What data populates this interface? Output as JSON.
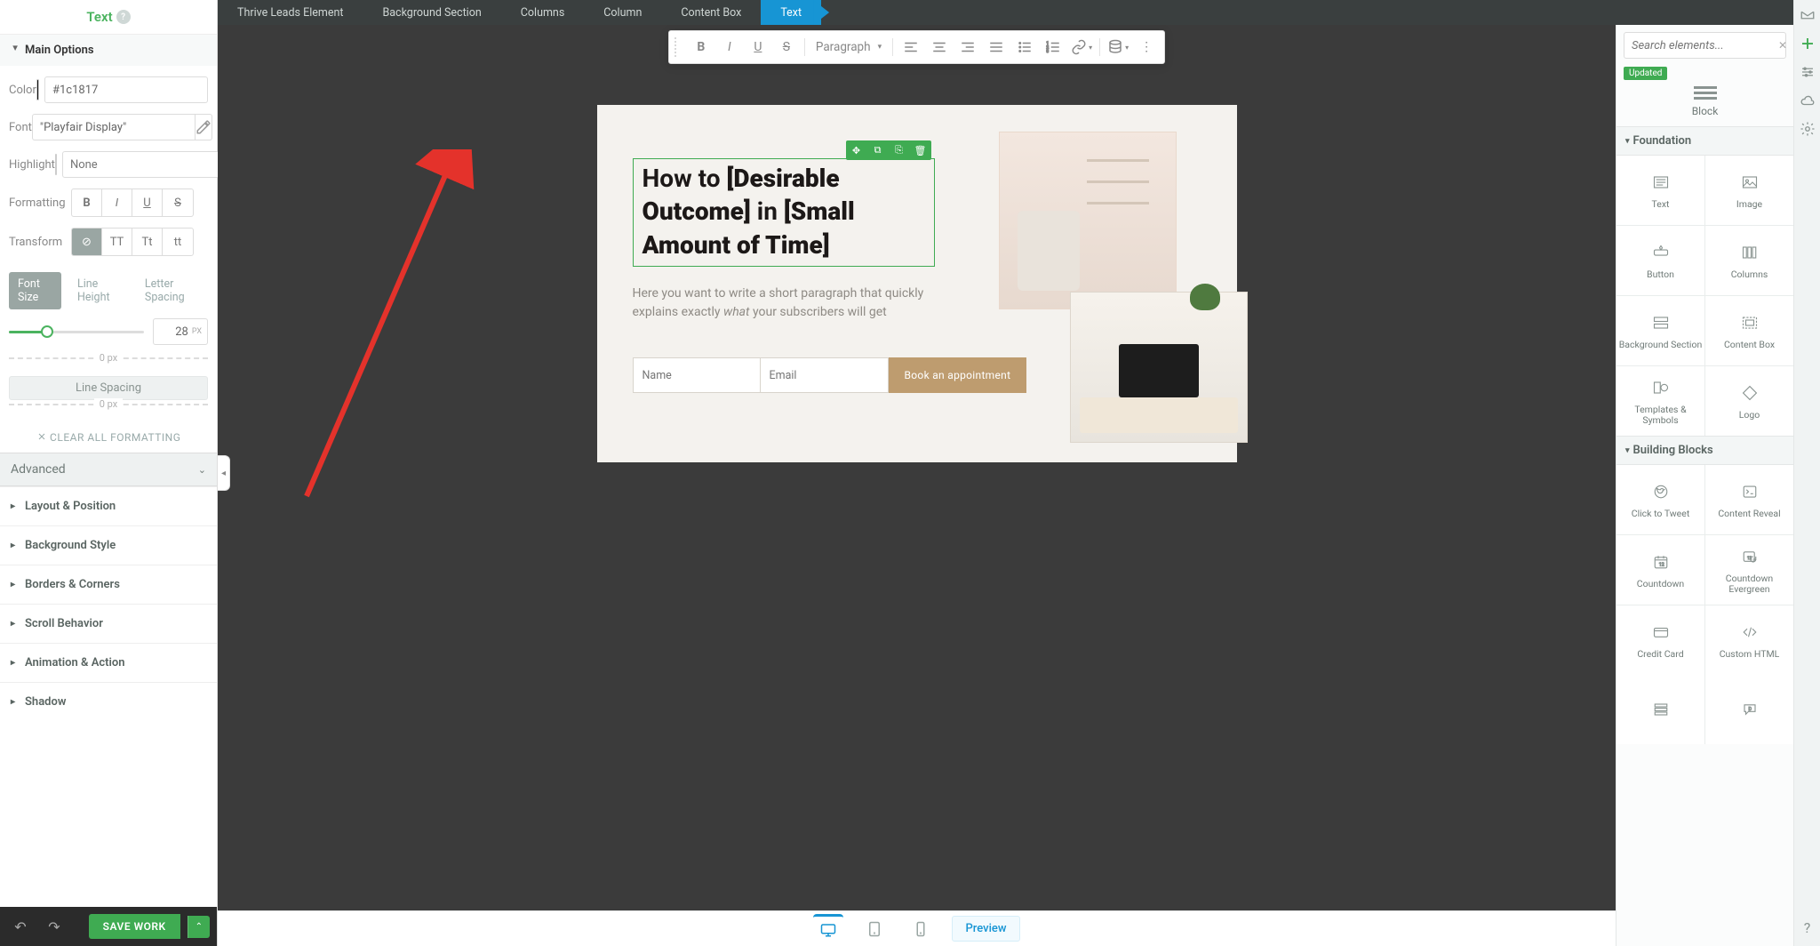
{
  "colors": {
    "accent_green": "#3fab52",
    "accent_blue": "#1795d4",
    "cta_tan": "#be9c6f"
  },
  "left": {
    "title": "Text",
    "main_options": "Main Options",
    "color_label": "Color",
    "color_value": "#1c1817",
    "font_label": "Font",
    "font_value": "\"Playfair Display\"",
    "highlight_label": "Highlight",
    "highlight_placeholder": "None",
    "formatting_label": "Formatting",
    "transform_label": "Transform",
    "tabs": {
      "font_size": "Font Size",
      "line_height": "Line Height",
      "letter_spacing": "Letter Spacing"
    },
    "size_value": "28",
    "size_unit": "PX",
    "spacing0a": "0 px",
    "line_spacing": "Line Spacing",
    "spacing0b": "0 px",
    "clear_all": "CLEAR ALL FORMATTING",
    "advanced": "Advanced",
    "sections": [
      "Layout & Position",
      "Background Style",
      "Borders & Corners",
      "Scroll Behavior",
      "Animation & Action",
      "Shadow"
    ],
    "save": "SAVE WORK"
  },
  "breadcrumbs": [
    "Thrive Leads Element",
    "Background Section",
    "Columns",
    "Column",
    "Content Box",
    "Text"
  ],
  "toolbar": {
    "paragraph": "Paragraph"
  },
  "page": {
    "title_a": "How to ",
    "title_b": "[Desirable Outcome]",
    "title_c": " in ",
    "title_d": "[Small Amount of Time]",
    "para_pre": "Here you want to write a short paragraph that quickly explains exactly ",
    "para_em": "what",
    "para_post": " your subscribers will get",
    "name_ph": "Name",
    "email_ph": "Email",
    "cta": "Book an appointment"
  },
  "right": {
    "search_placeholder": "Search elements...",
    "updated": "Updated",
    "block": "Block",
    "foundation": "Foundation",
    "building": "Building Blocks",
    "items_foundation": [
      "Text",
      "Image",
      "Button",
      "Columns",
      "Background Section",
      "Content Box",
      "Templates & Symbols",
      "Logo"
    ],
    "items_building": [
      "Click to Tweet",
      "Content Reveal",
      "Countdown",
      "Countdown Evergreen",
      "Credit Card",
      "Custom HTML"
    ]
  },
  "bottom": {
    "preview": "Preview"
  }
}
